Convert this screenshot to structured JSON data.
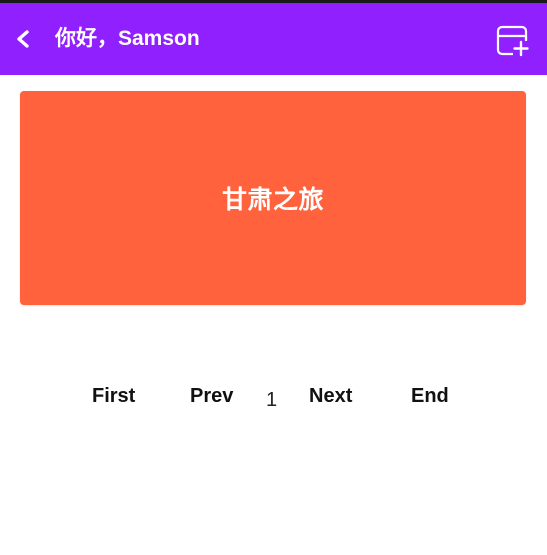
{
  "app_bar": {
    "back_label": "<",
    "title": "你好，Samson",
    "add_icon": "add-board-icon",
    "background_color": "#9020fd"
  },
  "trips": [
    {
      "title": "甘肃之旅",
      "color": "#ff623d"
    }
  ],
  "pagination": {
    "first_label": "First",
    "prev_label": "Prev",
    "current_page": "1",
    "next_label": "Next",
    "end_label": "End"
  }
}
